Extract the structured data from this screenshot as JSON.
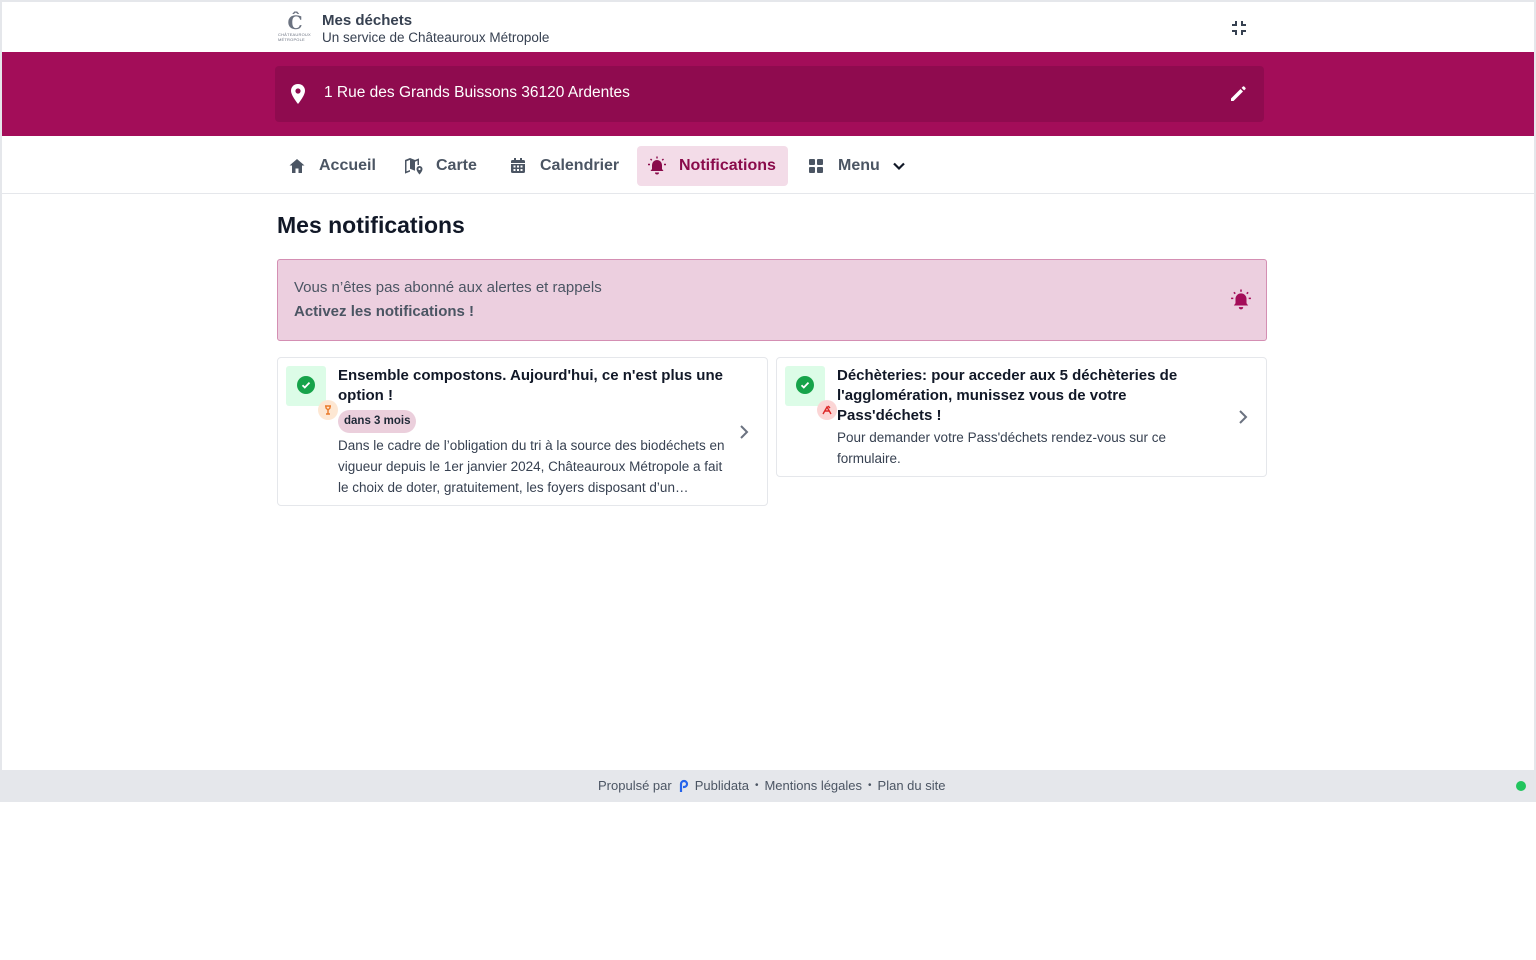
{
  "header": {
    "title": "Mes déchets",
    "subtitle": "Un service de Châteauroux Métropole",
    "logo_text": "CHÂTEAUROUX MÉTROPOLE",
    "collapse_icon": "collapse-icon"
  },
  "address": {
    "text": "1 Rue des Grands Buissons 36120 Ardentes",
    "pin_icon": "map-pin-icon",
    "edit_icon": "pencil-icon"
  },
  "nav": {
    "items": [
      {
        "label": "Accueil",
        "icon": "home-icon"
      },
      {
        "label": "Carte",
        "icon": "map-icon"
      },
      {
        "label": "Calendrier",
        "icon": "calendar-icon"
      },
      {
        "label": "Notifications",
        "icon": "bell-icon",
        "active": true
      },
      {
        "label": "Menu",
        "icon": "grid-icon"
      }
    ]
  },
  "page": {
    "title": "Mes notifications"
  },
  "alert": {
    "line1": "Vous n’êtes pas abonné aux alertes et rappels",
    "line2": "Activez les notifications !"
  },
  "cards": [
    {
      "title": "Ensemble compostons. Aujourd'hui, ce n'est plus une option !",
      "badge": "dans 3 mois",
      "body": "Dans le cadre de l’obligation du tri à la source des biodéchets en vigueur depuis le 1er janvier 2024, Châteauroux Métropole a fait le choix de doter, gratuitement, les foyers disposant d’un…",
      "icon": "compost-icon"
    },
    {
      "title": "Déchèteries: pour acceder aux 5 déchèteries de l'agglomération, munissez vous de votre Pass'déchets !",
      "body": "Pour demander votre Pass'déchets rendez-vous sur ce formulaire.",
      "icon": "recycling-center-icon"
    }
  ],
  "footer": {
    "powered_by": "Propulsé par",
    "brand": "Publidata",
    "legal": "Mentions légales",
    "sitemap": "Plan du site"
  },
  "colors": {
    "brand": "#a30d59",
    "brand_dark": "#8f0b4f",
    "active_bg": "#f3dce8",
    "alert_bg": "#eccfdf",
    "success": "#16a34a",
    "status": "#22c55e"
  }
}
